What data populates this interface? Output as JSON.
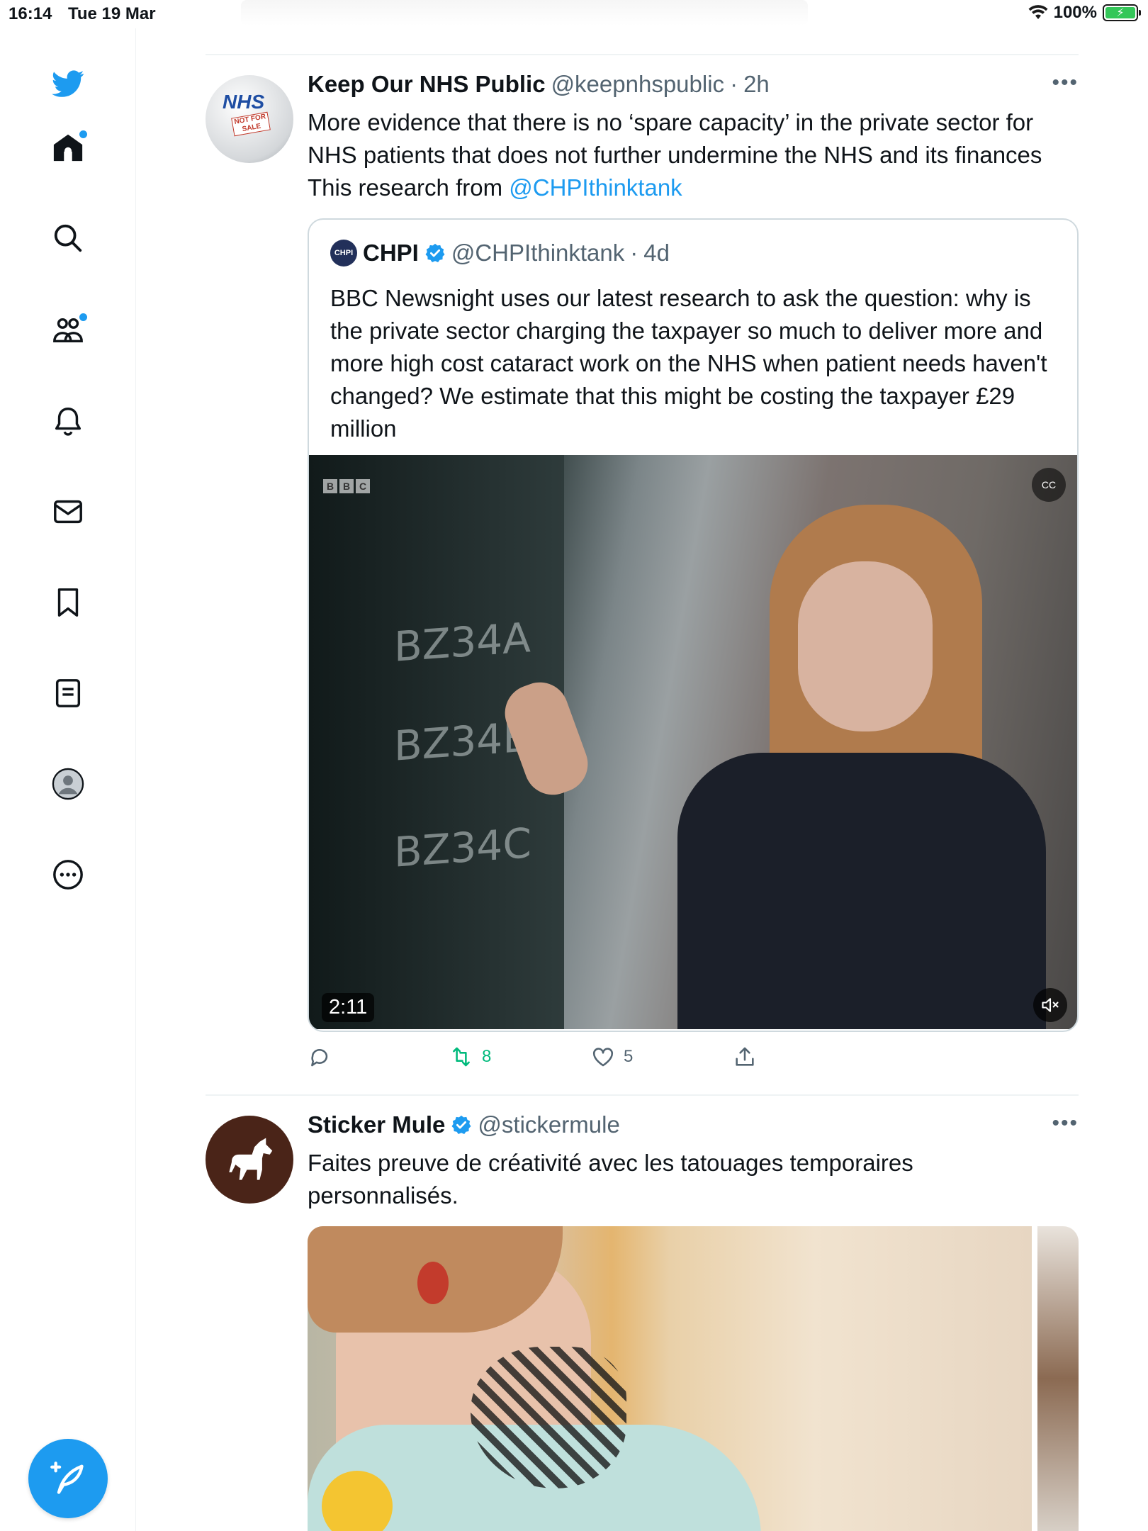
{
  "status_bar": {
    "time": "16:14",
    "date": "Tue 19 Mar",
    "battery": "100%"
  },
  "sidebar": {
    "items": [
      "home-icon",
      "search-icon",
      "communities-icon",
      "notifications-icon",
      "messages-icon",
      "bookmarks-icon",
      "lists-icon",
      "profile-icon",
      "more-icon"
    ],
    "compose_label": "compose-tweet-icon"
  },
  "tweets": [
    {
      "name": "Keep Our NHS Public",
      "handle": "@keepnhspublic",
      "sep": "·",
      "time": "2h",
      "text_1": "More evidence that there is no ‘spare capacity’ in the private sector for NHS patients that does not further undermine the NHS and its finances",
      "text_2": "This research from ",
      "mention": "@CHPIthinktank",
      "avatar_text": "NHS",
      "avatar_sub": "NOT FOR SALE",
      "quote": {
        "avatar_text": "CHPI",
        "name": "CHPI",
        "handle": "@CHPIthinktank",
        "sep": "·",
        "time": "4d",
        "text": "BBC Newsnight uses our latest research to ask the question: why is the private sector charging the taxpayer so much to deliver more and more high cost cataract work on the NHS when patient needs haven't changed?  We estimate that this might be costing the taxpayer £29 million",
        "video_duration": "2:11"
      },
      "actions": {
        "reply": "",
        "retweets": "8",
        "likes": "5"
      }
    },
    {
      "name": "Sticker Mule",
      "handle": "@stickermule",
      "text": "Faites preuve de créativité avec les tatouages temporaires personnalisés."
    }
  ],
  "colors": {
    "accent": "#1d9bf0",
    "retweet": "#00ba7c",
    "text": "#0f1419",
    "muted": "#536471"
  }
}
